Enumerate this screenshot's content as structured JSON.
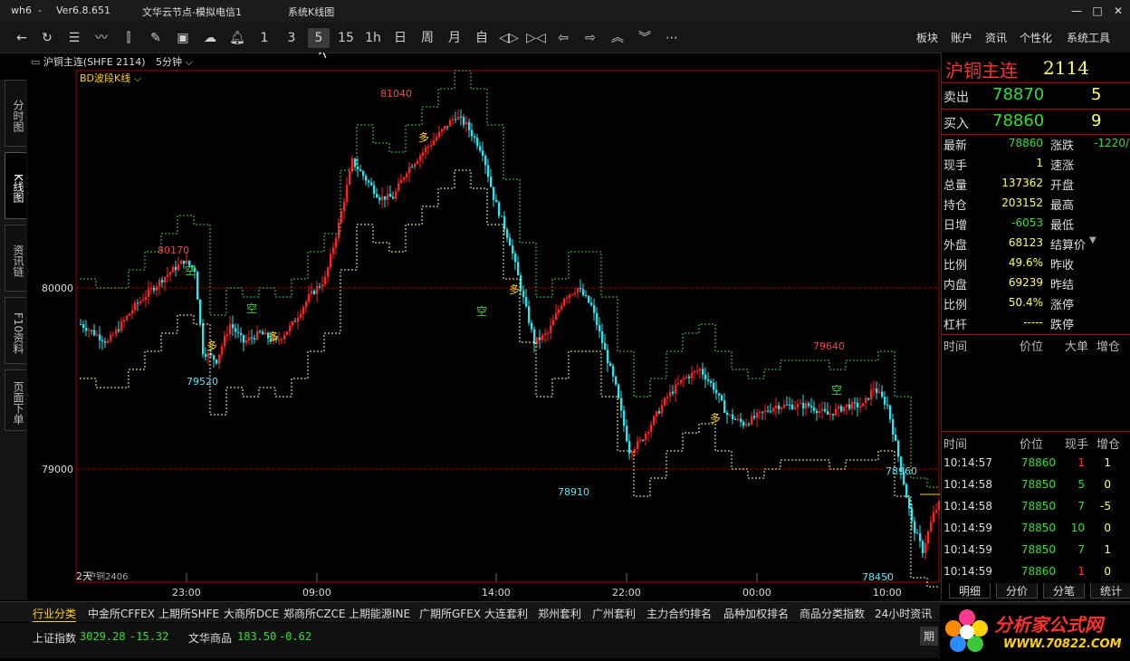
{
  "titlebar": {
    "user": "wh6",
    "dash": "-",
    "version": "Ver6.8.651",
    "server": "文华云节点-模拟电信1",
    "window": "系统K线图"
  },
  "toolbar": {
    "periods": [
      "1",
      "3",
      "5",
      "15",
      "1h",
      "日",
      "周",
      "月",
      "自"
    ],
    "selected_period": "5",
    "menu": [
      "板块",
      "账户",
      "资讯",
      "个性化",
      "系统工具"
    ]
  },
  "left_tabs": [
    "分时图",
    "K线图",
    "资讯链",
    "F10资料",
    "页面下单"
  ],
  "active_tab": "K线图",
  "chart_header": {
    "symbol": "沪铜主连(SHFE 2114)",
    "period": "5分钟",
    "indicator": "BD波段K线"
  },
  "chart_data": {
    "type": "candlestick",
    "y_ticks": [
      "80000",
      "79000"
    ],
    "x_ticks": [
      "23:00",
      "09:00",
      "14:00",
      "22:00",
      "00:00",
      "10:00"
    ],
    "annotations": [
      "80170",
      "79520",
      "81040",
      "78910",
      "79640",
      "78960",
      "78450"
    ],
    "ylim": [
      78300,
      81200
    ],
    "signals": [
      "空",
      "多",
      "多",
      "空",
      "多",
      "空",
      "多",
      "多",
      "空"
    ],
    "bottom_label": "2天",
    "contract_label": "沪铜2406",
    "colors": {
      "up": "#ff2020",
      "down": "#2ce4ee",
      "support": "#ffff99",
      "resistance": "#40d040"
    }
  },
  "right_panel": {
    "name": "沪铜主连",
    "code": "2114",
    "sell_label": "卖出",
    "sell_price": "78870",
    "sell_vol": "5",
    "buy_label": "买入",
    "buy_price": "78860",
    "buy_vol": "9",
    "stats": [
      {
        "k1": "最新",
        "v1": "78860",
        "k2": "涨跌",
        "v2": "-1220/"
      },
      {
        "k1": "现手",
        "v1": "1",
        "k2": "速涨",
        "v2": ""
      },
      {
        "k1": "总量",
        "v1": "137362",
        "k2": "开盘",
        "v2": ""
      },
      {
        "k1": "持仓",
        "v1": "203152",
        "k2": "最高",
        "v2": ""
      },
      {
        "k1": "日增",
        "v1": "-6053",
        "k2": "最低",
        "v2": ""
      },
      {
        "k1": "外盘",
        "v1": "68123",
        "k2": "结算价",
        "v2": ""
      },
      {
        "k1": "比例",
        "v1": "49.6%",
        "k2": "昨收",
        "v2": ""
      },
      {
        "k1": "内盘",
        "v1": "69239",
        "k2": "昨结",
        "v2": ""
      },
      {
        "k1": "比例",
        "v1": "50.4%",
        "k2": "涨停",
        "v2": ""
      },
      {
        "k1": "杠杆",
        "v1": "-----",
        "k2": "跌停",
        "v2": ""
      }
    ],
    "big_header": [
      "时间",
      "价位",
      "大单",
      "增仓"
    ],
    "ticks_header": [
      "时间",
      "价位",
      "现手",
      "增仓"
    ],
    "ticks": [
      {
        "time": "10:14:57",
        "price": "78860",
        "vol": "1",
        "chg": "1"
      },
      {
        "time": "10:14:58",
        "price": "78850",
        "vol": "5",
        "chg": "0"
      },
      {
        "time": "10:14:58",
        "price": "78850",
        "vol": "7",
        "chg": "-5"
      },
      {
        "time": "10:14:59",
        "price": "78850",
        "vol": "10",
        "chg": "0"
      },
      {
        "time": "10:14:59",
        "price": "78850",
        "vol": "7",
        "chg": "1"
      },
      {
        "time": "10:14:59",
        "price": "78860",
        "vol": "1",
        "chg": "0"
      }
    ],
    "bottom_tabs": [
      "明细",
      "分价",
      "分笔",
      "统计"
    ]
  },
  "bottom_tabs": [
    "行业分类",
    "中金所CFFEX",
    "上期所SHFE",
    "大商所DCE",
    "郑商所CZCE",
    "上期能源INE",
    "广期所GFEX",
    "大连套利",
    "郑州套利",
    "广州套利",
    "主力合约排名",
    "品种加权排名",
    "商品分类指数",
    "24小时资讯"
  ],
  "status": {
    "index1_name": "上证指数",
    "index1_val": "3029.28",
    "index1_chg": "-15.32",
    "index2_name": "文华商品",
    "index2_val": "183.50",
    "index2_chg": "-0.62",
    "right_btn": "期"
  },
  "logo": {
    "text": "分析家公式网",
    "url": "WWW.70822.COM"
  }
}
